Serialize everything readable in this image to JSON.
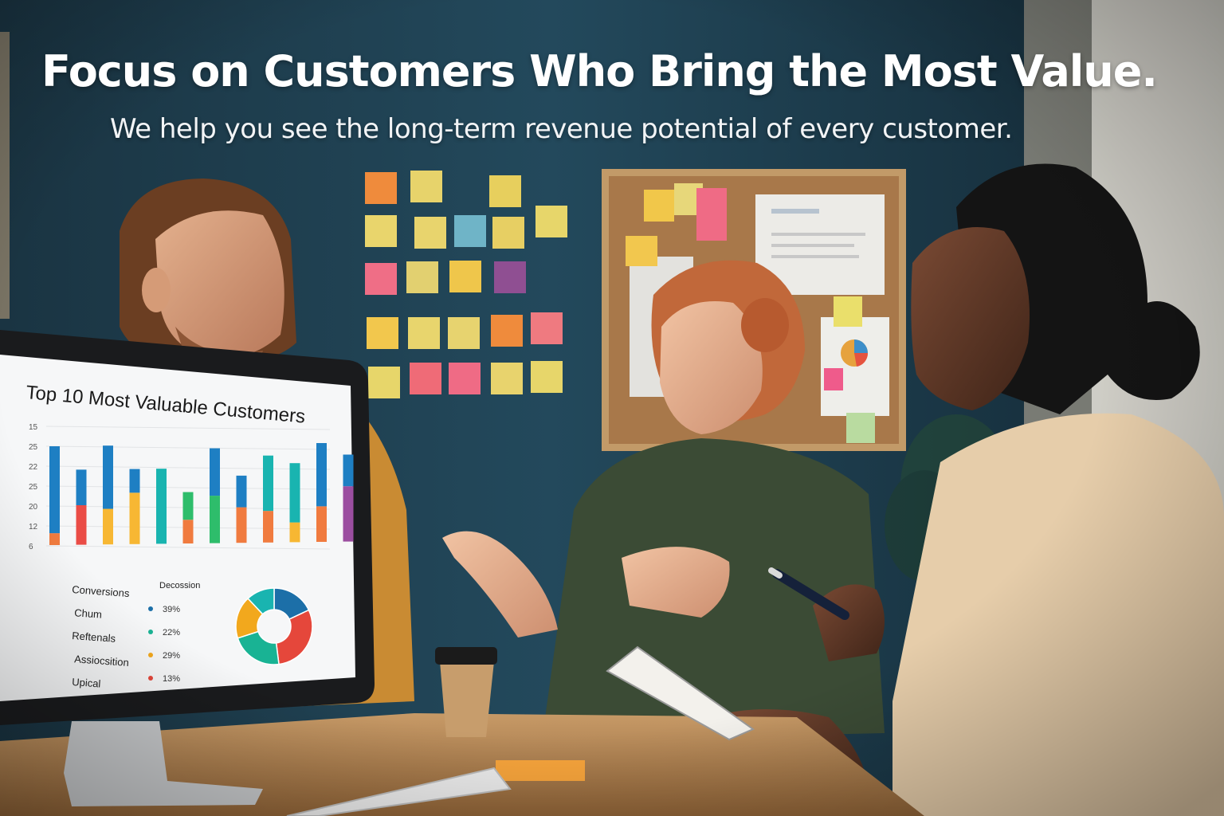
{
  "hero": {
    "headline": "Focus on Customers Who Bring the Most Value.",
    "subheadline": "We help you see the long-term revenue potential of every customer."
  },
  "screen": {
    "title": "Top 10 Most Valuable Customers",
    "y_ticks": [
      "15",
      "25",
      "22",
      "25",
      "20",
      "12",
      "6"
    ],
    "legend_rows": [
      {
        "label": "Conversions",
        "header": "Decossion"
      },
      {
        "label": "Chum",
        "value": "39%",
        "color": "#1c6fa8"
      },
      {
        "label": "Reftenals",
        "value": "22%",
        "color": "#19b394"
      },
      {
        "label": "Assiocsition",
        "value": "29%",
        "color": "#f2a81d"
      },
      {
        "label": "Upical",
        "value": "13%",
        "color": "#e5473b"
      }
    ],
    "bars": [
      {
        "top": 22,
        "bottom": 3,
        "top_color": "#1e7fc3",
        "bottom_color": "#f07b3f"
      },
      {
        "top": 9,
        "bottom": 10,
        "top_color": "#1e7fc3",
        "bottom_color": "#ea4c46"
      },
      {
        "top": 16,
        "bottom": 9,
        "top_color": "#1e7fc3",
        "bottom_color": "#f7b733"
      },
      {
        "top": 6,
        "bottom": 13,
        "top_color": "#1e7fc3",
        "bottom_color": "#f7b733"
      },
      {
        "top": 19,
        "bottom": 0,
        "top_color": "#19b4b0",
        "bottom_color": "#19b4b0"
      },
      {
        "top": 7,
        "bottom": 6,
        "top_color": "#2ebd6b",
        "bottom_color": "#f07b3f"
      },
      {
        "top": 12,
        "bottom": 12,
        "top_color": "#1e7fc3",
        "bottom_color": "#2ebd6b"
      },
      {
        "top": 8,
        "bottom": 9,
        "top_color": "#1e7fc3",
        "bottom_color": "#f07b3f"
      },
      {
        "top": 14,
        "bottom": 8,
        "top_color": "#19b4b0",
        "bottom_color": "#f07b3f"
      },
      {
        "top": 15,
        "bottom": 5,
        "top_color": "#19b4b0",
        "bottom_color": "#f7b733"
      },
      {
        "top": 16,
        "bottom": 9,
        "top_color": "#1e7fc3",
        "bottom_color": "#f07b3f"
      },
      {
        "top": 8,
        "bottom": 14,
        "top_color": "#1e7fc3",
        "bottom_color": "#9b4ea0"
      }
    ],
    "donut": [
      {
        "value": 18,
        "color": "#1c6fa8"
      },
      {
        "value": 30,
        "color": "#e5473b"
      },
      {
        "value": 22,
        "color": "#19b394"
      },
      {
        "value": 18,
        "color": "#f2a81d"
      },
      {
        "value": 12,
        "color": "#19b4b0"
      }
    ]
  },
  "colors": {
    "wall": "#22475a",
    "wall_dark": "#172f3e",
    "desk": "#b98b59",
    "corkboard": "#b88b5a",
    "frame": "#c69a67"
  }
}
